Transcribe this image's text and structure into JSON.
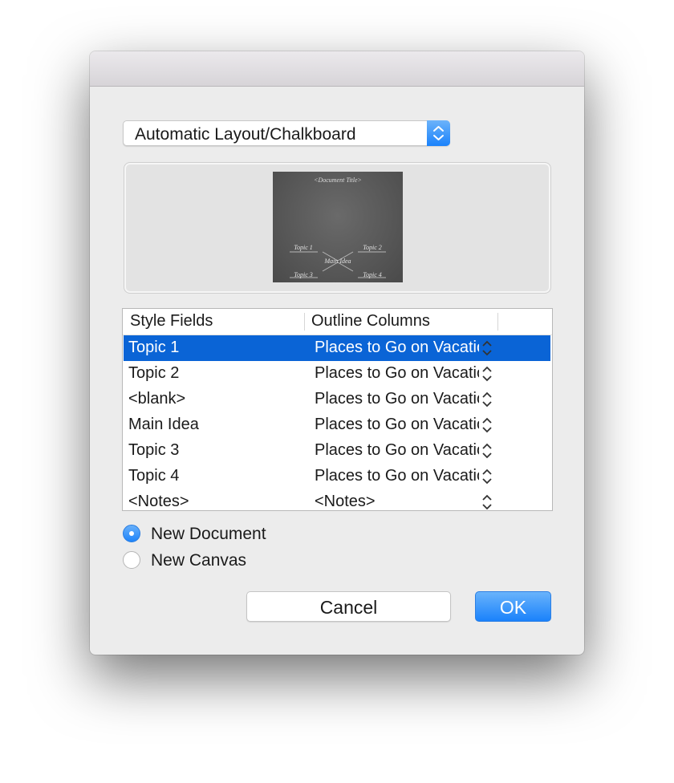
{
  "popup": {
    "selected": "Automatic Layout/Chalkboard"
  },
  "preview": {
    "title": "<Document Title>",
    "main": "Main Idea",
    "topics": [
      "Topic 1",
      "Topic 2",
      "Topic 3",
      "Topic 4"
    ]
  },
  "table": {
    "headers": [
      "Style Fields",
      "Outline Columns"
    ],
    "rows": [
      {
        "field": "Topic 1",
        "column": "Places to Go on Vacation"
      },
      {
        "field": "Topic 2",
        "column": "Places to Go on Vacation"
      },
      {
        "field": "<blank>",
        "column": "Places to Go on Vacation"
      },
      {
        "field": "Main Idea",
        "column": "Places to Go on Vacation"
      },
      {
        "field": "Topic 3",
        "column": "Places to Go on Vacation"
      },
      {
        "field": "Topic 4",
        "column": "Places to Go on Vacation"
      },
      {
        "field": "<Notes>",
        "column": "<Notes>"
      }
    ],
    "selected_row": 0
  },
  "destination": {
    "options": [
      "New Document",
      "New Canvas"
    ],
    "selected": "New Document"
  },
  "buttons": {
    "cancel": "Cancel",
    "ok": "OK"
  },
  "colors": {
    "accent": "#1a82fb",
    "selection": "#0a64d6"
  }
}
